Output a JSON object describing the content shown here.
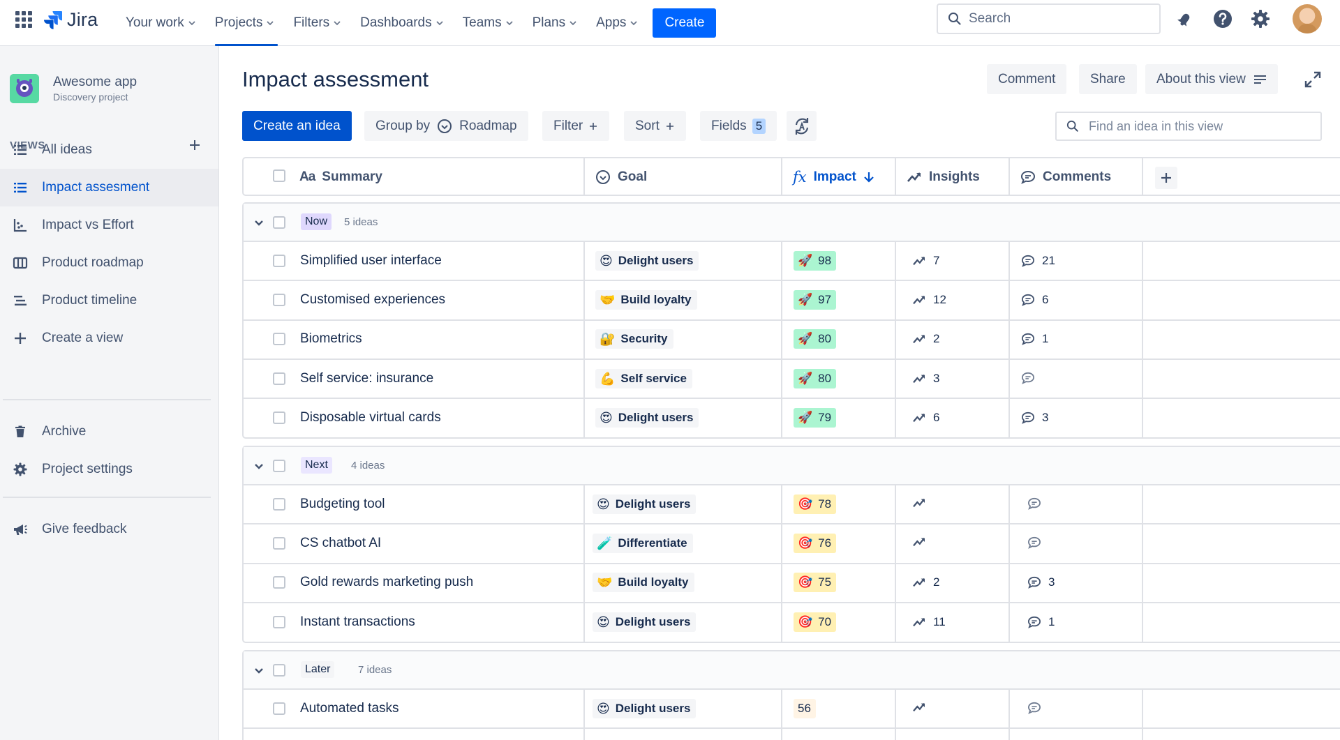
{
  "topnav": {
    "brand": "Jira",
    "items": [
      {
        "label": "Your work",
        "active": false
      },
      {
        "label": "Projects",
        "active": true
      },
      {
        "label": "Filters",
        "active": false
      },
      {
        "label": "Dashboards",
        "active": false
      },
      {
        "label": "Teams",
        "active": false
      },
      {
        "label": "Plans",
        "active": false
      },
      {
        "label": "Apps",
        "active": false
      }
    ],
    "create_label": "Create",
    "search_placeholder": "Search"
  },
  "sidebar": {
    "project_name": "Awesome app",
    "project_type": "Discovery project",
    "views_label": "VIEWS",
    "views": [
      {
        "label": "All ideas",
        "icon": "list-icon",
        "selected": false
      },
      {
        "label": "Impact assesment",
        "icon": "list-icon",
        "selected": true
      },
      {
        "label": "Impact vs Effort",
        "icon": "matrix-icon",
        "selected": false
      },
      {
        "label": "Product roadmap",
        "icon": "board-icon",
        "selected": false
      },
      {
        "label": "Product timeline",
        "icon": "timeline-icon",
        "selected": false
      },
      {
        "label": "Create a view",
        "icon": "plus-icon",
        "selected": false
      }
    ],
    "archive_label": "Archive",
    "settings_label": "Project settings",
    "feedback_label": "Give feedback"
  },
  "main": {
    "title": "Impact assessment",
    "comment_label": "Comment",
    "share_label": "Share",
    "about_label": "About this view",
    "toolbar": {
      "create_idea": "Create an idea",
      "group_by": "Group by",
      "group_by_value": "Roadmap",
      "filter": "Filter",
      "sort": "Sort",
      "fields": "Fields",
      "fields_count": "5",
      "search_placeholder": "Find an idea in this view"
    },
    "columns": {
      "summary": "Summary",
      "goal": "Goal",
      "impact": "Impact",
      "insights": "Insights",
      "comments": "Comments"
    }
  },
  "groups": [
    {
      "label": "Now",
      "count": "5 ideas",
      "color": "#dfd8fd",
      "rows": [
        {
          "summary": "Simplified user interface",
          "goal": "Delight users",
          "goal_emoji": "😍",
          "impact": "98",
          "impact_emoji": "🚀",
          "impact_color": "#abf5d1",
          "insights": "7",
          "comments": "21"
        },
        {
          "summary": "Customised experiences",
          "goal": "Build loyalty",
          "goal_emoji": "🤝",
          "impact": "97",
          "impact_emoji": "🚀",
          "impact_color": "#abf5d1",
          "insights": "12",
          "comments": "6"
        },
        {
          "summary": "Biometrics",
          "goal": "Security",
          "goal_emoji": "🔐",
          "impact": "80",
          "impact_emoji": "🚀",
          "impact_color": "#abf5d1",
          "insights": "2",
          "comments": "1"
        },
        {
          "summary": "Self service: insurance",
          "goal": "Self service",
          "goal_emoji": "💪",
          "impact": "80",
          "impact_emoji": "🚀",
          "impact_color": "#abf5d1",
          "insights": "3",
          "comments": ""
        },
        {
          "summary": "Disposable virtual cards",
          "goal": "Delight users",
          "goal_emoji": "😍",
          "impact": "79",
          "impact_emoji": "🚀",
          "impact_color": "#abf5d1",
          "insights": "6",
          "comments": "3"
        }
      ]
    },
    {
      "label": "Next",
      "count": "4 ideas",
      "color": "#eae6ff",
      "rows": [
        {
          "summary": "Budgeting tool",
          "goal": "Delight users",
          "goal_emoji": "😍",
          "impact": "78",
          "impact_emoji": "🎯",
          "impact_color": "#fff0b3",
          "insights": "",
          "comments": ""
        },
        {
          "summary": "CS chatbot AI",
          "goal": "Differentiate",
          "goal_emoji": "🧪",
          "impact": "76",
          "impact_emoji": "🎯",
          "impact_color": "#fff0b3",
          "insights": "",
          "comments": ""
        },
        {
          "summary": "Gold rewards marketing push",
          "goal": "Build loyalty",
          "goal_emoji": "🤝",
          "impact": "75",
          "impact_emoji": "🎯",
          "impact_color": "#fff0b3",
          "insights": "2",
          "comments": "3"
        },
        {
          "summary": "Instant transactions",
          "goal": "Delight users",
          "goal_emoji": "😍",
          "impact": "70",
          "impact_emoji": "🎯",
          "impact_color": "#fff0b3",
          "insights": "11",
          "comments": "1"
        }
      ]
    },
    {
      "label": "Later",
      "count": "7 ideas",
      "color": "#f4f5f7",
      "rows": [
        {
          "summary": "Automated tasks",
          "goal": "Delight users",
          "goal_emoji": "😍",
          "impact": "56",
          "impact_emoji": "",
          "impact_color": "#fff4e5",
          "insights": "",
          "comments": ""
        }
      ]
    }
  ]
}
